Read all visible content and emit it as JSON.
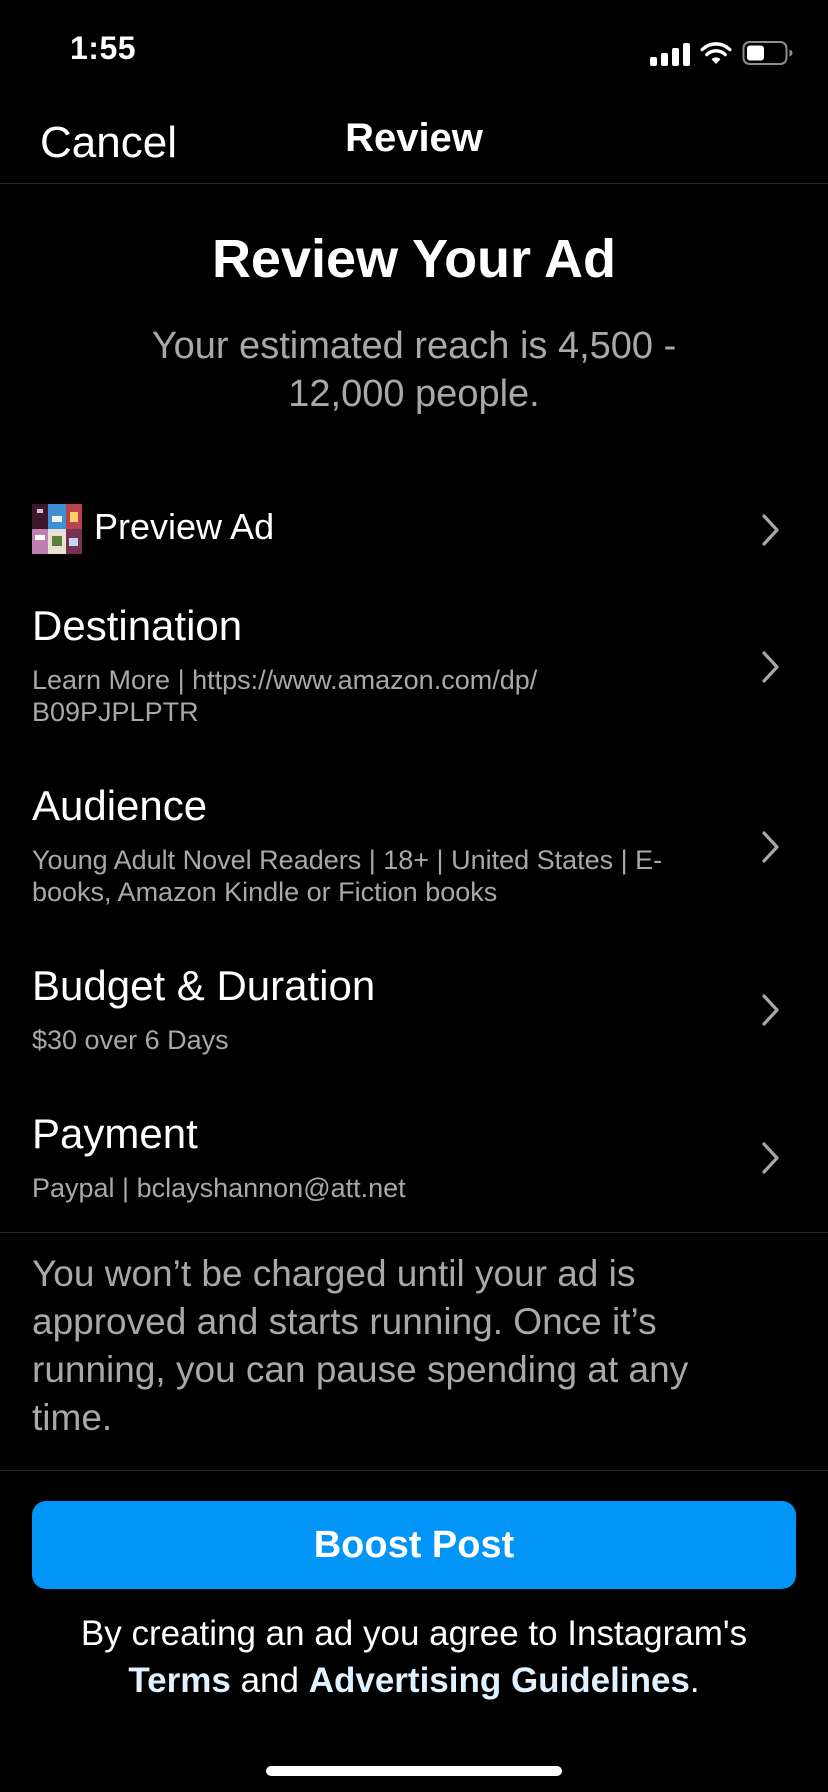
{
  "status_bar": {
    "time": "1:55",
    "icons": [
      "signal-icon",
      "wifi-icon",
      "battery-icon"
    ]
  },
  "nav": {
    "cancel_label": "Cancel",
    "title": "Review"
  },
  "header": {
    "title": "Review Your Ad",
    "reach_text": "Your estimated reach is 4,500 - 12,000 people."
  },
  "preview": {
    "label": "Preview Ad",
    "thumbnail_icon": "book-collage-thumbnail"
  },
  "rows": [
    {
      "title": "Destination",
      "subtitle": "Learn More | https://www.amazon.com/dp/ B09PJPLPTR"
    },
    {
      "title": "Audience",
      "subtitle": "Young Adult Novel Readers | 18+ | United States | E-books, Amazon Kindle or Fiction books"
    },
    {
      "title": "Budget & Duration",
      "subtitle": "$30 over 6 Days"
    },
    {
      "title": "Payment",
      "subtitle": "Paypal | bclayshannon@att.net"
    }
  ],
  "disclaimer": "You won’t be charged until your ad is approved and starts running. Once it’s running, you can pause spending at any time.",
  "boost_button_label": "Boost Post",
  "legal": {
    "prefix": "By creating an ad you agree to Instagram's",
    "terms_link": "Terms",
    "and": "and",
    "guidelines_link": "Advertising Guidelines",
    "suffix": "."
  },
  "colors": {
    "background": "#000000",
    "accent": "#0095f6",
    "secondary_text": "#a8a8a8",
    "divider": "#262626"
  }
}
